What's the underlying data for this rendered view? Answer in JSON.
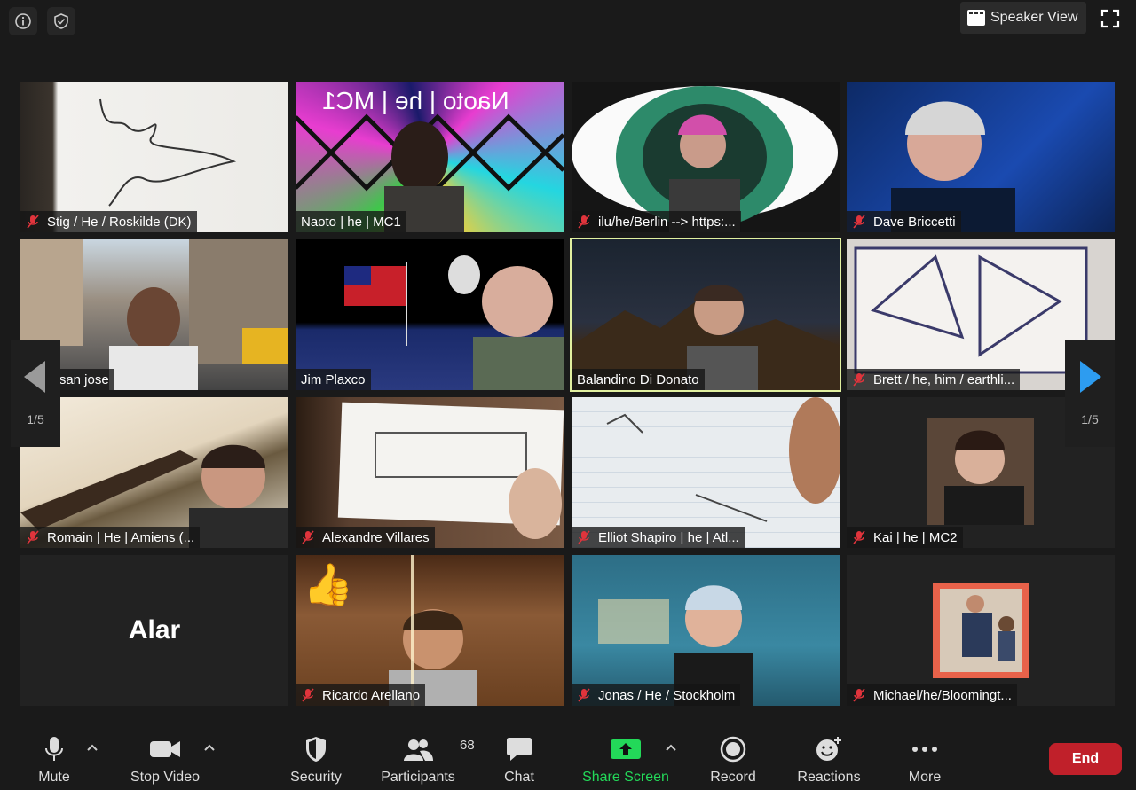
{
  "topbar": {
    "speaker_view_label": "Speaker View"
  },
  "participants": [
    {
      "name": "Stig / He / Roskilde (DK)"
    },
    {
      "name": "Naoto | he | MC1"
    },
    {
      "name": "ilu/he/Berlin --> https:..."
    },
    {
      "name": "Dave Briccetti"
    },
    {
      "name": "er|he|san jose"
    },
    {
      "name": "Jim Plaxco"
    },
    {
      "name": "Balandino Di Donato"
    },
    {
      "name": "Brett / he, him / earthli..."
    },
    {
      "name": "Romain | He | Amiens (..."
    },
    {
      "name": "Alexandre Villares"
    },
    {
      "name": "Elliot Shapiro | he | Atl..."
    },
    {
      "name": "Kai | he | MC2"
    },
    {
      "name": "Alar",
      "avatar_text": "Alar"
    },
    {
      "name": "Ricardo Arellano"
    },
    {
      "name": "Jonas / He / Stockholm"
    },
    {
      "name": "Michael/he/Bloomingt..."
    }
  ],
  "tile_overlay_text": {
    "naoto_mirrored": "Naoto | he | MC1"
  },
  "pagination": {
    "left": "1/5",
    "right": "1/5"
  },
  "toolbar": {
    "mute": "Mute",
    "stop_video": "Stop Video",
    "security": "Security",
    "participants": "Participants",
    "participants_count": "68",
    "chat": "Chat",
    "share_screen": "Share Screen",
    "record": "Record",
    "reactions": "Reactions",
    "more": "More",
    "end": "End"
  },
  "colors": {
    "active_speaker_border": "#e1f0a0",
    "share_green": "#23d959",
    "end_red": "#c0202a",
    "nav_arrow_blue": "#2d9cf0",
    "muted_mic_red": "#e0343c"
  }
}
